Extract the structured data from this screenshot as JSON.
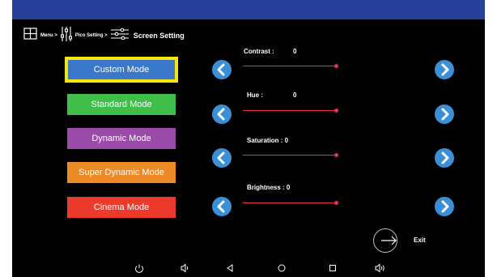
{
  "breadcrumb": {
    "menu": "Menu >",
    "pico": "Pico Setting >",
    "screen": "Screen Setting"
  },
  "modes": [
    {
      "label": "Custom Mode",
      "color": "#3b78c9",
      "selected": true
    },
    {
      "label": "Standard Mode",
      "color": "#3fbf4a",
      "selected": false
    },
    {
      "label": "Dynamic Mode",
      "color": "#9a4aa8",
      "selected": false
    },
    {
      "label": "Super Dynamic Mode",
      "color": "#ec8a27",
      "selected": false
    },
    {
      "label": "Cinema Mode",
      "color": "#ec3b2c",
      "selected": false
    }
  ],
  "sliders": [
    {
      "label": "Contrast :",
      "value": "0"
    },
    {
      "label": "Hue :",
      "value": "0"
    },
    {
      "label": "Saturation : 0",
      "value": ""
    },
    {
      "label": "Brightness : 0",
      "value": ""
    }
  ],
  "exit": {
    "label": "Exit"
  },
  "colors": {
    "topbar": "#26409a",
    "accent": "#3b8fd6",
    "slider": "#e8334f",
    "selected_border": "#f5e60b"
  },
  "navbar_icons": [
    "power-icon",
    "volume-down-icon",
    "back-icon",
    "home-icon",
    "recents-icon",
    "volume-up-icon"
  ]
}
